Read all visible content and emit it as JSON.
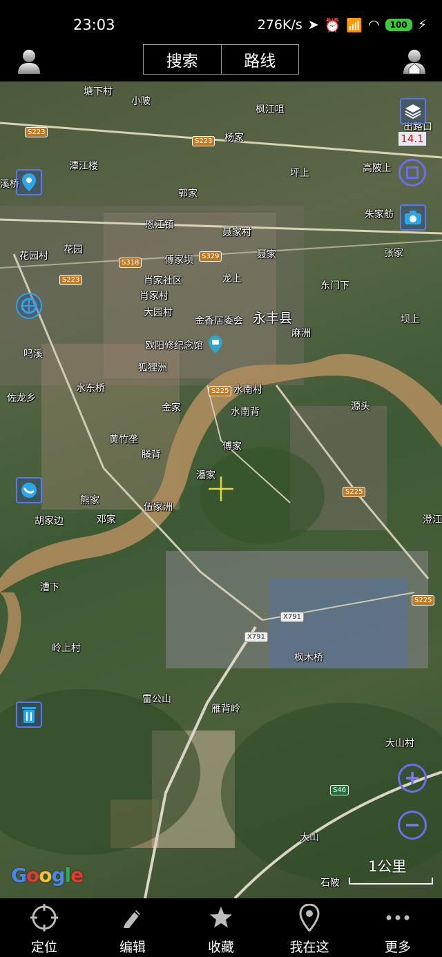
{
  "status_bar": {
    "time": "23:03",
    "net_speed": "276K/s",
    "battery": "100"
  },
  "top_bar": {
    "search_label": "搜索",
    "route_label": "路线"
  },
  "map": {
    "altitude_badge": "14.1",
    "google_logo": "Google",
    "scale_label": "1公里",
    "labels": {
      "l01": "塘下村",
      "l02": "小陂",
      "l03": "枫江咀",
      "l04": "杨家",
      "l05": "出路口",
      "l06": "潭江楼",
      "l07": "坪上",
      "l08": "高陂上",
      "l09": "郭家",
      "l10": "溪桥",
      "l11": "朱家舫",
      "l12": "恩江镇",
      "l13": "聂家村",
      "l14": "花园村",
      "l15": "花园",
      "l16": "傅家坝",
      "l17": "聂家",
      "l18": "张家",
      "l19": "肖家社区",
      "l20": "龙上",
      "l21": "东门下",
      "l22": "肖家村",
      "l23": "大园村",
      "l24": "金香居委会",
      "l25": "永丰县",
      "l26": "坝上",
      "l27": "麻洲",
      "l28": "欧阳修纪念馆",
      "l29": "狐狸洲",
      "l30": "鸣溪",
      "l31": "水东桥",
      "l32": "水南村",
      "l33": "佐龙乡",
      "l34": "金家",
      "l35": "水南背",
      "l36": "源头",
      "l37": "黄竹垄",
      "l38": "傅家",
      "l39": "滕背",
      "l40": "潘家",
      "l41": "熊家",
      "l42": "伍家洲",
      "l43": "胡家边",
      "l44": "邓家",
      "l45": "漕下",
      "l46": "枫木桥",
      "l47": "岭上村",
      "l48": "雷公山",
      "l49": "雁背岭",
      "l50": "大山村",
      "l51": "大山",
      "l52": "石陂",
      "l53": "澄江"
    },
    "road_shields": {
      "s1": "S223",
      "s2": "S223",
      "s3": "S318",
      "s4": "S329",
      "s5": "S223",
      "s6": "S225",
      "s7": "S225",
      "s8": "S225",
      "s9": "X791",
      "s10": "X791",
      "s11": "S46"
    }
  },
  "bottom_nav": {
    "items": [
      {
        "label": "定位",
        "icon": "locate-icon"
      },
      {
        "label": "编辑",
        "icon": "pencil-icon"
      },
      {
        "label": "收藏",
        "icon": "star-icon"
      },
      {
        "label": "我在这",
        "icon": "pin-icon"
      },
      {
        "label": "更多",
        "icon": "more-icon"
      }
    ]
  }
}
